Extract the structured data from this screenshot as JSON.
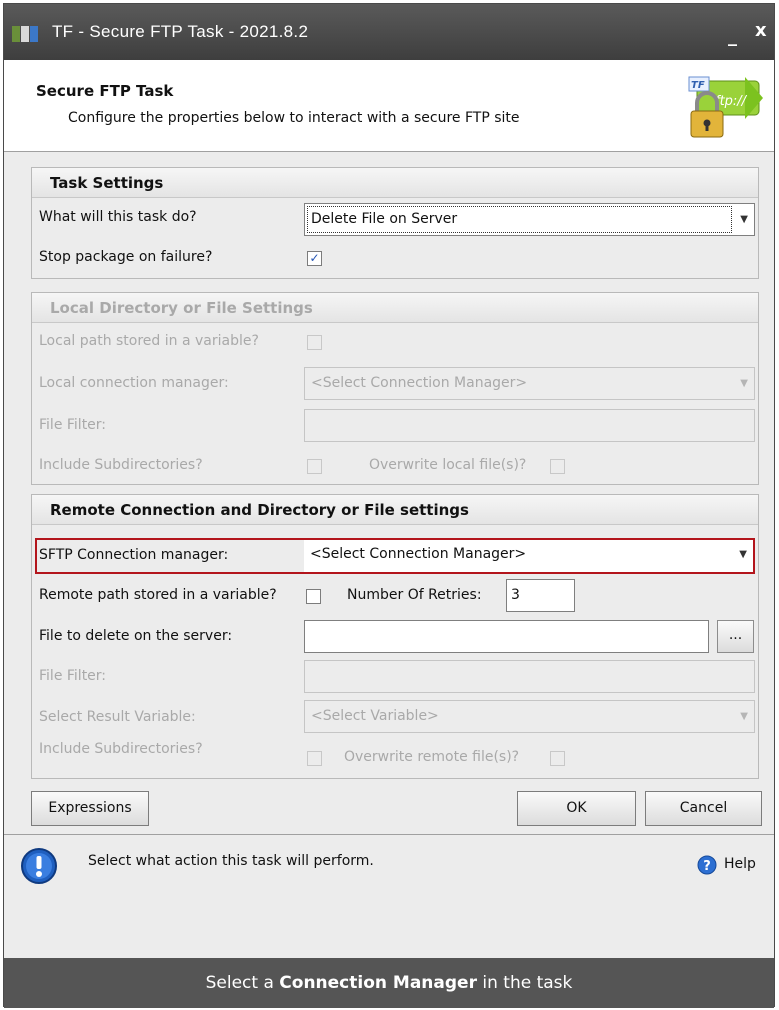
{
  "window": {
    "title": "TF - Secure FTP Task - 2021.8.2",
    "minimize_glyph": "_",
    "close_glyph": "x"
  },
  "header": {
    "title": "Secure FTP Task",
    "subtitle": "Configure the properties below to interact with a secure FTP site",
    "logo_text": "ftp://",
    "logo_badge": "TF"
  },
  "task_settings": {
    "heading": "Task Settings",
    "action_label": "What will this task do?",
    "action_value": "Delete File on Server",
    "stop_label": "Stop package on failure?",
    "stop_checked": true
  },
  "local_settings": {
    "heading": "Local Directory or File Settings",
    "path_var_label": "Local path stored in a variable?",
    "conn_label": "Local connection manager:",
    "conn_value": "<Select Connection Manager>",
    "filter_label": "File Filter:",
    "subdirs_label": "Include Subdirectories?",
    "overwrite_label": "Overwrite local file(s)?"
  },
  "remote_settings": {
    "heading": "Remote Connection and Directory or File settings",
    "conn_label": "SFTP Connection manager:",
    "conn_value": "<Select Connection Manager>",
    "path_var_label": "Remote path stored in a variable?",
    "retries_label": "Number Of Retries:",
    "retries_value": "3",
    "delete_label": "File to delete on the server:",
    "browse_label": "...",
    "filter_label": "File Filter:",
    "result_label": "Select Result Variable:",
    "result_value": "<Select Variable>",
    "subdirs_label": "Include Subdirectories?",
    "overwrite_label": "Overwrite remote file(s)?"
  },
  "buttons": {
    "expressions": "Expressions",
    "ok": "OK",
    "cancel": "Cancel"
  },
  "status": {
    "message": "Select what action this task will perform.",
    "help": "Help"
  },
  "caption": {
    "prefix": "Select a ",
    "bold": "Connection Manager",
    "suffix": " in the task"
  },
  "colors": {
    "highlight": "#b3151c",
    "check": "#2555b5",
    "caption_bg": "#555555",
    "info_blue": "#1f5fbf"
  }
}
